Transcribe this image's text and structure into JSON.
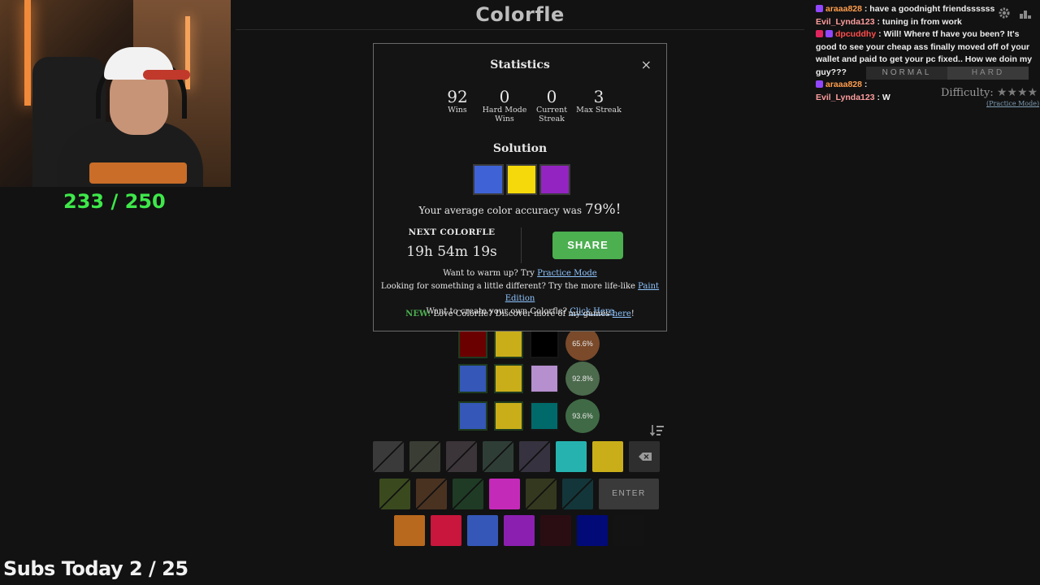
{
  "app": {
    "title": "Colorfle"
  },
  "stream": {
    "goal_text": "233 / 250",
    "subs_text": "Subs Today  2 / 25"
  },
  "chat": [
    {
      "user": "araaa828",
      "text": " : have a goodnight friendssssss"
    },
    {
      "user": "Evil_Lynda123",
      "text": " : tuning in from work"
    },
    {
      "user": "dpcuddhy",
      "text": " : Will! Where tf have you been? It's good to see your cheap ass finally moved off of your wallet and paid to get your pc fixed.. How we doin my guy???"
    },
    {
      "user": "araaa828",
      "text": " :"
    },
    {
      "user": "Evil_Lynda123",
      "text": " : W"
    }
  ],
  "difficulty": {
    "normal": "NORMAL",
    "hard": "HARD",
    "label": "Difficulty:",
    "stars": "★★★★",
    "practice": "(Practice Mode)"
  },
  "modal": {
    "title": "Statistics",
    "close": "×",
    "stats": [
      {
        "value": "92",
        "label": "Wins"
      },
      {
        "value": "0",
        "label": "Hard Mode Wins"
      },
      {
        "value": "0",
        "label": "Current Streak"
      },
      {
        "value": "3",
        "label": "Max Streak"
      }
    ],
    "solution_title": "Solution",
    "solution_colors": [
      "#3f63d6",
      "#f5d90a",
      "#9424c2"
    ],
    "accuracy_prefix": "Your average color accuracy was ",
    "accuracy_value": "79%!",
    "next_label": "NEXT COLORFLE",
    "timer": "19h 54m 19s",
    "share_label": "SHARE",
    "links": {
      "warm_prefix": "Want to warm up? Try ",
      "warm_link": "Practice Mode",
      "different_prefix": "Looking for something a little different? Try the more life-like ",
      "different_link": "Paint Edition",
      "create_prefix": "Want to create your own Colorfle? ",
      "create_link": "Click Here",
      "new_tag": "NEW:",
      "new_prefix": " Love Colorfle? Discover more of my games ",
      "new_link": "here",
      "new_suffix": "!"
    }
  },
  "board": [
    {
      "colors": [
        "#6b0000",
        "#c9ae1a",
        "#000000"
      ],
      "score": "65.6%",
      "score_color": "#7a4a2a"
    },
    {
      "colors": [
        "#3457b8",
        "#c9ae1a",
        "#b58fce"
      ],
      "score": "92.8%",
      "score_color": "#4c6a4c"
    },
    {
      "colors": [
        "#3457b8",
        "#c9ae1a",
        "#006a6a"
      ],
      "score": "93.6%",
      "score_color": "#3f6a45"
    }
  ],
  "keyboard": {
    "row1": [
      {
        "color": "#3a3a3a",
        "used": true
      },
      {
        "color": "#3a3d33",
        "used": true
      },
      {
        "color": "#3b3438",
        "used": true
      },
      {
        "color": "#2f3d37",
        "used": true
      },
      {
        "color": "#36323f",
        "used": true
      },
      {
        "color": "#26b3b0",
        "used": false
      },
      {
        "color": "#c9ae1a",
        "used": false
      }
    ],
    "row2": [
      {
        "color": "#3a4a1e",
        "used": true
      },
      {
        "color": "#4a3221",
        "used": true
      },
      {
        "color": "#1f3b25",
        "used": true
      },
      {
        "color": "#c42ab8",
        "used": false
      },
      {
        "color": "#34381e",
        "used": true
      },
      {
        "color": "#13363a",
        "used": true
      }
    ],
    "enter_label": "ENTER",
    "row3": [
      {
        "color": "#b8691e",
        "used": false
      },
      {
        "color": "#c8163c",
        "used": false
      },
      {
        "color": "#3457b8",
        "used": false
      },
      {
        "color": "#8b1fb0",
        "used": false
      },
      {
        "color": "#2a0d12",
        "used": false
      },
      {
        "color": "#020a78",
        "used": false
      },
      {
        "color": "#131313",
        "used": false
      }
    ]
  }
}
